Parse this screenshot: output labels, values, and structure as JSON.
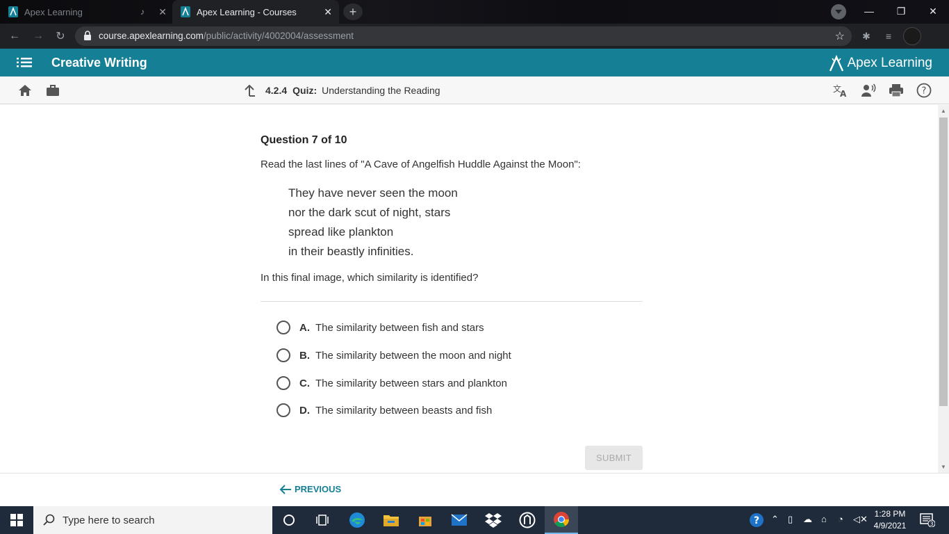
{
  "browser": {
    "tabs": [
      {
        "title": "Apex Learning",
        "active": false
      },
      {
        "title": "Apex Learning - Courses",
        "active": true
      }
    ],
    "url_host": "course.apexlearning.com",
    "url_path": "/public/activity/4002004/assessment"
  },
  "app": {
    "course_title": "Creative Writing",
    "brand": "Apex Learning",
    "activity_number": "4.2.4",
    "activity_type": "Quiz:",
    "activity_title": "Understanding the Reading"
  },
  "quiz": {
    "header": "Question 7 of 10",
    "prompt": "Read the last lines of \"A Cave of Angelfish Huddle Against the Moon\":",
    "poem_lines": [
      "They have never seen the moon",
      "nor the dark scut of night, stars",
      "spread like plankton",
      "in their beastly infinities."
    ],
    "question": "In this final image, which similarity is identified?",
    "choices": [
      {
        "letter": "A.",
        "text": "The similarity between fish and stars"
      },
      {
        "letter": "B.",
        "text": "The similarity between the moon and night"
      },
      {
        "letter": "C.",
        "text": "The similarity between stars and plankton"
      },
      {
        "letter": "D.",
        "text": "The similarity between beasts and fish"
      }
    ],
    "submit_label": "SUBMIT",
    "previous_label": "PREVIOUS"
  },
  "taskbar": {
    "search_placeholder": "Type here to search",
    "time": "1:28 PM",
    "date": "4/9/2021",
    "notification_count": "3"
  },
  "colors": {
    "accent": "#157f95",
    "taskbar": "#1f2a3a"
  }
}
